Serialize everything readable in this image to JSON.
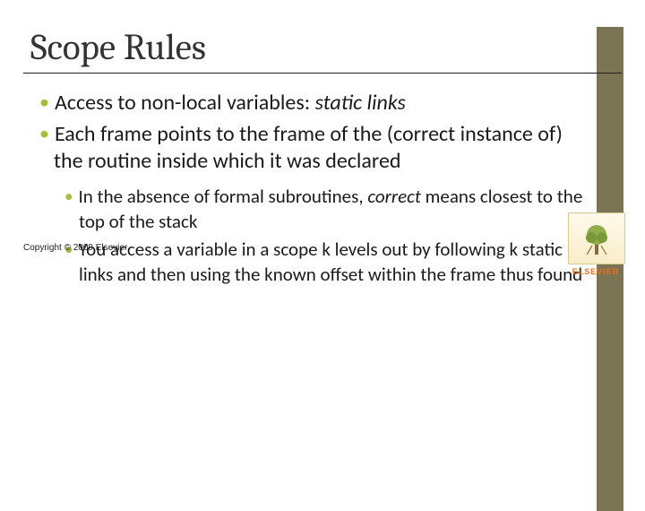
{
  "slide": {
    "title": "Scope Rules",
    "bullets_l1": [
      {
        "pre": "Access to non-local variables: ",
        "em": "static links",
        "post": ""
      },
      {
        "pre": "Each frame points to the frame of the (correct instance of)  the routine inside which it was declared",
        "em": "",
        "post": ""
      }
    ],
    "bullets_l2": [
      {
        "pre": "In the absence of formal subroutines, ",
        "em": "correct",
        "post": " means closest to the top of the stack"
      },
      {
        "pre": "You access a variable in a scope k levels out by following k static links and then using the known offset within the frame thus found",
        "em": "",
        "post": ""
      }
    ],
    "copyright": "Copyright © 2009 Elsevier",
    "logo_text": "ELSEVIER"
  }
}
